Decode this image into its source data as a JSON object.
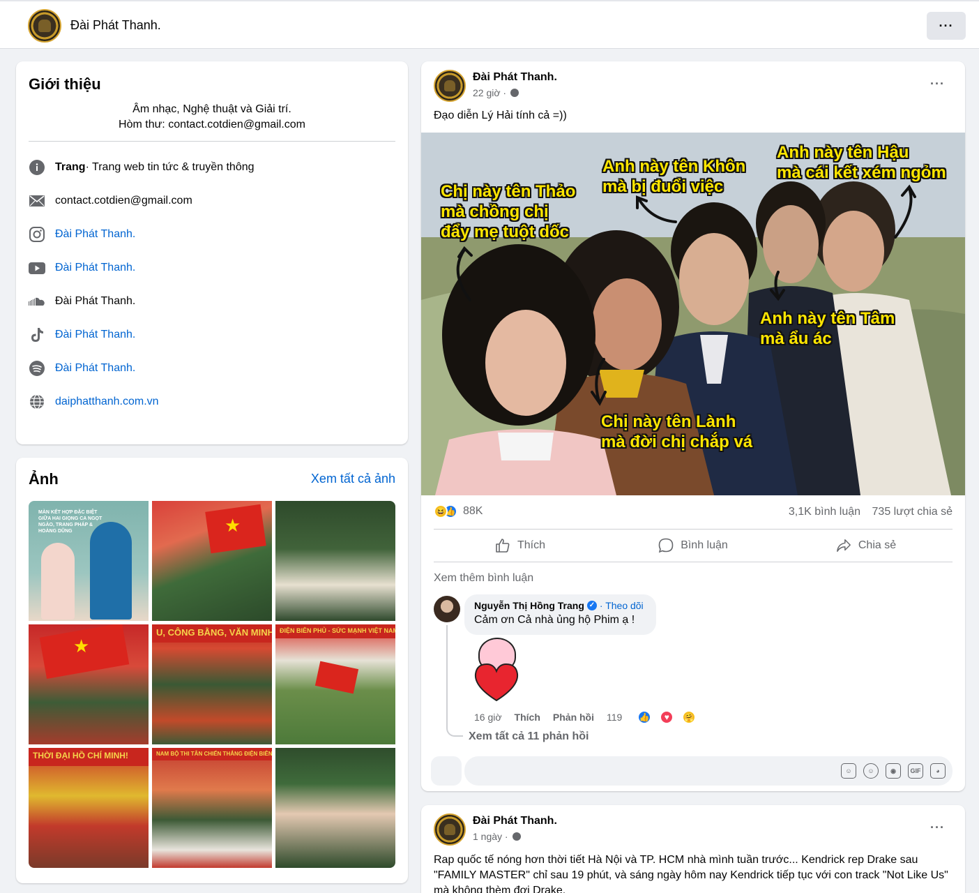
{
  "header": {
    "title": "Đài Phát Thanh.",
    "more_label": "···"
  },
  "intro": {
    "heading": "Giới thiệu",
    "bio_line1": "Âm nhạc, Nghệ thuật và Giải trí.",
    "bio_line2": "Hòm thư: contact.cotdien@gmail.com",
    "items": [
      {
        "icon": "info-icon",
        "bold": "Trang",
        "text": " · Trang web tin tức & truyền thông"
      },
      {
        "icon": "mail-icon",
        "text": "contact.cotdien@gmail.com"
      },
      {
        "icon": "instagram-icon",
        "text": "Đài Phát Thanh."
      },
      {
        "icon": "youtube-icon",
        "text": "Đài Phát Thanh."
      },
      {
        "icon": "soundcloud-icon",
        "text": "Đài Phát Thanh."
      },
      {
        "icon": "tiktok-icon",
        "text": "Đài Phát Thanh."
      },
      {
        "icon": "spotify-icon",
        "text": "Đài Phát Thanh."
      },
      {
        "icon": "globe-icon",
        "text": "daiphatthanh.com.vn"
      }
    ]
  },
  "photos": {
    "heading": "Ảnh",
    "see_all": "Xem tất cả ảnh",
    "photo1_caption": "MÀN KẾT HỢP ĐẶC BIỆT GIỮA HAI GIỌNG CA NGỌT NGÀO, TRANG PHÁP & HOÀNG DŨNG",
    "photo5_banner": "U, CÔNG BẰNG, VĂN MINH",
    "photo6_banner": "ĐIỆN BIÊN PHỦ - SỨC MẠNH VIỆT NAM THỜI ĐẠI HỒ",
    "photo7_banner": "THỜI ĐẠI HỒ CHÍ MINH!",
    "photo8_banner": "NAM BỘ THI TÂN CHIẾN THẮNG ĐIỆN BIÊN PHỦ TRONG CÔNG C"
  },
  "post": {
    "author": "Đài Phát Thanh.",
    "time": "22 giờ ·",
    "more_label": "···",
    "text": "Đạo diễn Lý Hải tính cả =))",
    "meme": {
      "label_thao": [
        "Chị này tên Thảo",
        "mà chồng chị",
        "đẩy mẹ tuột dốc"
      ],
      "label_khon": [
        "Anh này tên Khôn",
        "mà bị đuổi việc"
      ],
      "label_hau": [
        "Anh này tên Hậu",
        "mà cái kết xém ngỏm"
      ],
      "label_tam": [
        "Anh này tên Tâm",
        "mà ẩu ác"
      ],
      "label_lanh": [
        "Chị này tên Lành",
        "mà đời chị chắp vá"
      ]
    },
    "reaction_count": "88K",
    "comments_count": "3,1K bình luận",
    "shares_count": "735 lượt chia sẻ",
    "actions": {
      "like": "Thích",
      "comment": "Bình luận",
      "share": "Chia sẻ"
    },
    "more_comments": "Xem thêm bình luận",
    "comment": {
      "author": "Nguyễn Thị Hồng Trang",
      "follow": "· Theo dõi",
      "text": "Cảm ơn Cả nhà ủng hộ Phim ạ !",
      "time": "16 giờ",
      "like": "Thích",
      "reply": "Phản hồi",
      "reactions": "119"
    },
    "view_replies": "Xem tất cả 11 phản hồi"
  },
  "post2": {
    "author": "Đài Phát Thanh.",
    "time": "1 ngày ·",
    "more_label": "···",
    "text": "Rap quốc tế nóng hơn thời tiết Hà Nội và TP. HCM nhà mình tuần trước... Kendrick rep Drake sau \"FAMILY MASTER\" chỉ sau 19 phút, và sáng ngày hôm nay Kendrick tiếp tục với con track \"Not Like Us\" mà không thèm đợi Drake."
  },
  "colors": {
    "link": "#0064d1",
    "meme_text": "#ffe600",
    "background": "#f0f2f5"
  }
}
